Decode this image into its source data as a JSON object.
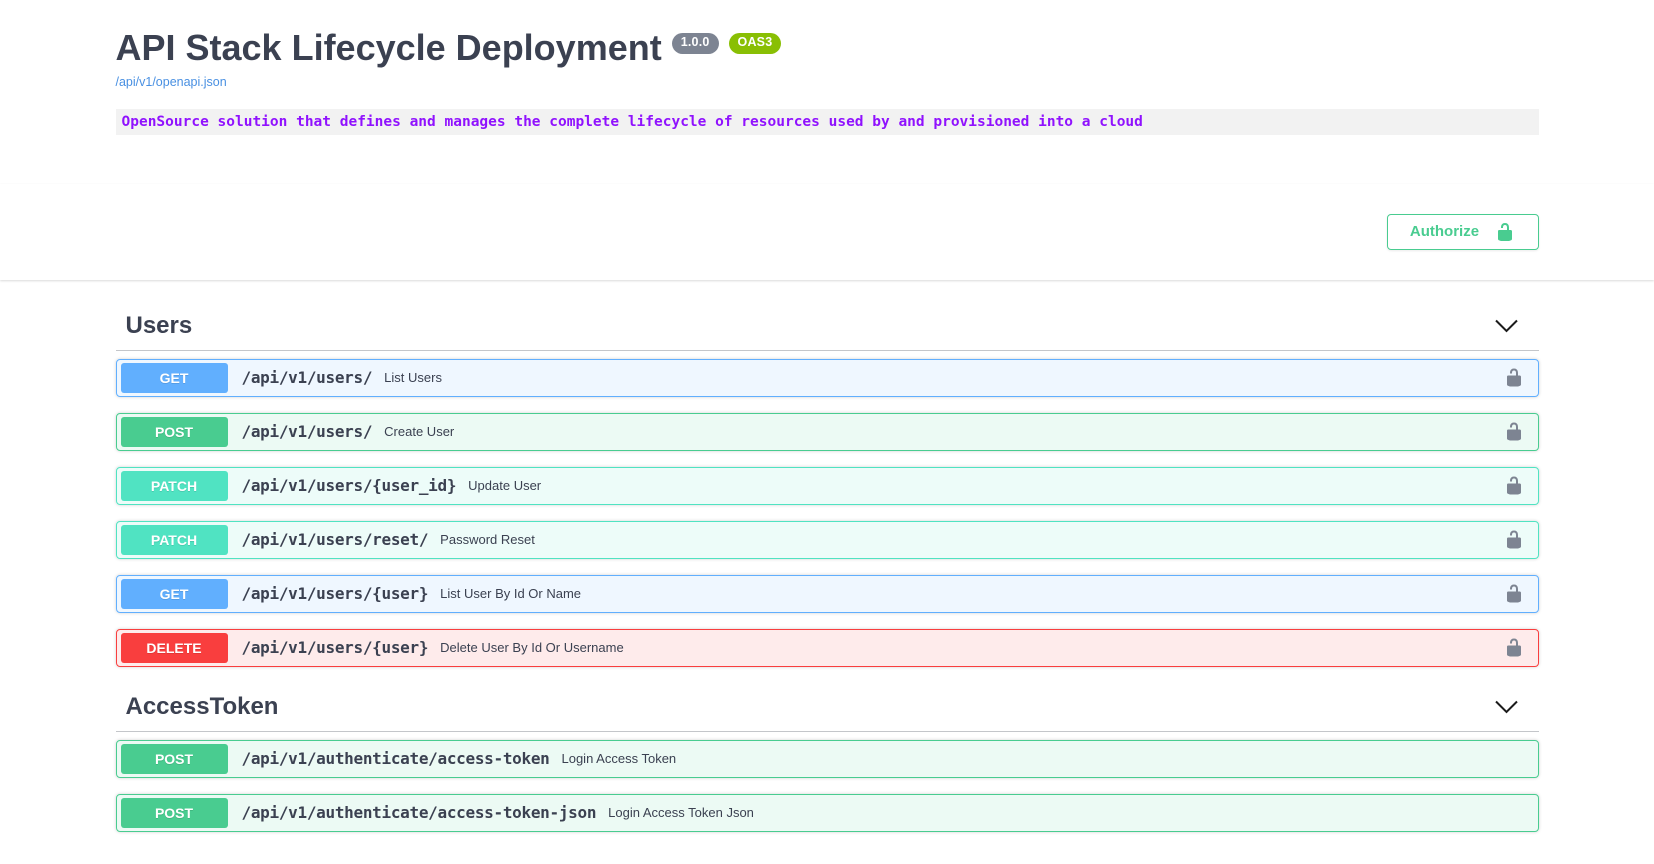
{
  "info": {
    "title": "API Stack Lifecycle Deployment",
    "version_badge": "1.0.0",
    "oas_badge": "OAS3",
    "spec_link": "/api/v1/openapi.json",
    "description": "OpenSource solution that defines and manages the complete lifecycle of resources used by and provisioned into a cloud"
  },
  "auth": {
    "authorize_label": "Authorize",
    "authorize_icon": "unlock-icon"
  },
  "icons": {
    "section_expand": "chevron-down-icon",
    "operation_auth": "unlock-icon"
  },
  "colors": {
    "get": "#61affe",
    "post": "#49cc90",
    "patch": "#50e3c2",
    "delete": "#f93e3e",
    "accent_green": "#49cc90",
    "text": "#3b4151",
    "code_purple": "#9012fe",
    "version_pill": "#7d8492",
    "oas_pill": "#89bf04",
    "lock_gray": "#7d8492",
    "link_blue": "#4990e2"
  },
  "sections": [
    {
      "name": "Users",
      "operations": [
        {
          "method": "GET",
          "path": "/api/v1/users/",
          "summary": "List Users",
          "locked": true
        },
        {
          "method": "POST",
          "path": "/api/v1/users/",
          "summary": "Create User",
          "locked": true
        },
        {
          "method": "PATCH",
          "path": "/api/v1/users/{user_id}",
          "summary": "Update User",
          "locked": true
        },
        {
          "method": "PATCH",
          "path": "/api/v1/users/reset/",
          "summary": "Password Reset",
          "locked": true
        },
        {
          "method": "GET",
          "path": "/api/v1/users/{user}",
          "summary": "List User By Id Or Name",
          "locked": true
        },
        {
          "method": "DELETE",
          "path": "/api/v1/users/{user}",
          "summary": "Delete User By Id Or Username",
          "locked": true
        }
      ]
    },
    {
      "name": "AccessToken",
      "operations": [
        {
          "method": "POST",
          "path": "/api/v1/authenticate/access-token",
          "summary": "Login Access Token",
          "locked": false
        },
        {
          "method": "POST",
          "path": "/api/v1/authenticate/access-token-json",
          "summary": "Login Access Token Json",
          "locked": false
        }
      ]
    }
  ]
}
